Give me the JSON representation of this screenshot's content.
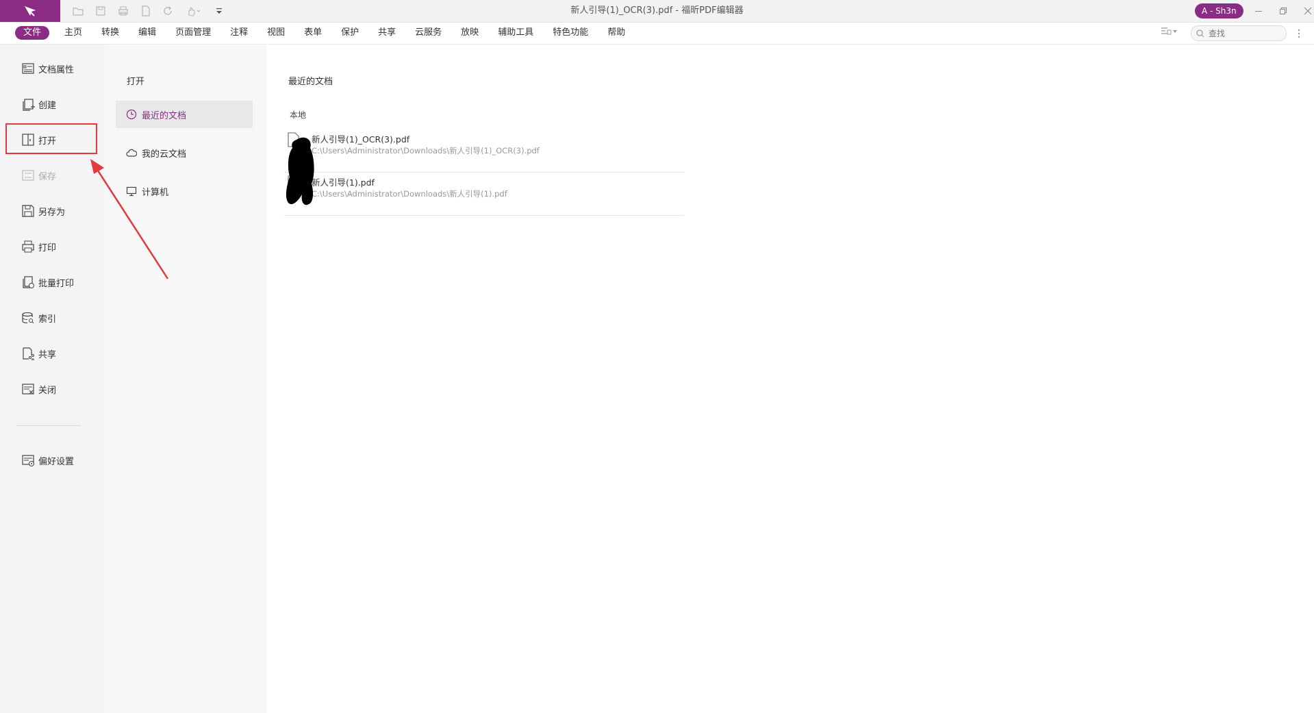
{
  "window": {
    "title": "新人引导(1)_OCR(3).pdf - 福昕PDF编辑器",
    "account": "A - Sh3n"
  },
  "quick_access": [
    {
      "name": "open-file-icon"
    },
    {
      "name": "save-icon"
    },
    {
      "name": "print-icon"
    },
    {
      "name": "new-doc-icon"
    },
    {
      "name": "redo-icon"
    },
    {
      "name": "hand-tool-icon"
    },
    {
      "name": "customize-qat-icon"
    }
  ],
  "menu": {
    "items": [
      "文件",
      "主页",
      "转换",
      "编辑",
      "页面管理",
      "注释",
      "视图",
      "表单",
      "保护",
      "共享",
      "云服务",
      "放映",
      "辅助工具",
      "特色功能",
      "帮助"
    ],
    "active_index": 0
  },
  "search": {
    "placeholder": "查找"
  },
  "left_nav": {
    "items": [
      {
        "label": "文档属性",
        "icon": "document-properties-icon"
      },
      {
        "label": "创建",
        "icon": "create-icon"
      },
      {
        "label": "打开",
        "icon": "open-icon"
      },
      {
        "label": "保存",
        "icon": "save-icon"
      },
      {
        "label": "另存为",
        "icon": "save-as-icon"
      },
      {
        "label": "打印",
        "icon": "print-icon"
      },
      {
        "label": "批量打印",
        "icon": "batch-print-icon"
      },
      {
        "label": "索引",
        "icon": "index-icon"
      },
      {
        "label": "共享",
        "icon": "share-icon"
      },
      {
        "label": "关闭",
        "icon": "close-doc-icon"
      }
    ],
    "preferences": {
      "label": "偏好设置",
      "icon": "preferences-icon"
    },
    "disabled_item": "保存"
  },
  "open_panel": {
    "title": "打开",
    "items": [
      {
        "label": "最近的文档",
        "icon": "clock-icon"
      },
      {
        "label": "我的云文档",
        "icon": "cloud-icon"
      },
      {
        "label": "计算机",
        "icon": "computer-icon"
      }
    ],
    "selected_index": 0
  },
  "recent": {
    "title": "最近的文档",
    "group": "本地",
    "files": [
      {
        "name": "新人引导(1)_OCR(3).pdf",
        "path": "C:\\Users\\Administrator\\Downloads\\新人引导(1)_OCR(3).pdf"
      },
      {
        "name": "新人引导(1).pdf",
        "path": "C:\\Users\\Administrator\\Downloads\\新人引导(1).pdf"
      }
    ]
  },
  "colors": {
    "brand": "#8a2c84",
    "highlight": "#e0393e",
    "nav_bg": "#f4f4f4",
    "panel_bg": "#f7f7f7"
  }
}
